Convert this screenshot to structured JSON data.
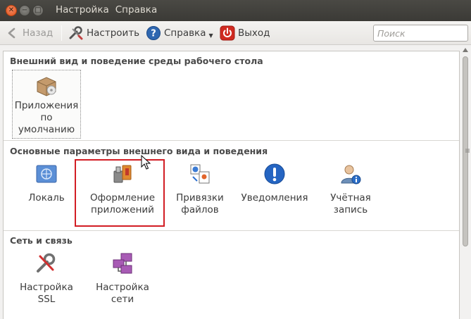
{
  "titlebar": {
    "menus": [
      "Настройка",
      "Справка"
    ]
  },
  "toolbar": {
    "back_label": "Назад",
    "configure_label": "Настроить",
    "help_label": "Справка",
    "exit_label": "Выход",
    "search_placeholder": "Поиск"
  },
  "sections": [
    {
      "title": "Внешний вид и поведение среды рабочего стола",
      "items": [
        {
          "label_lines": [
            "Приложения",
            "по",
            "умолчанию"
          ],
          "icon": "default-applications-icon"
        }
      ]
    },
    {
      "title": "Основные параметры внешнего вида и поведения",
      "items": [
        {
          "label_lines": [
            "Локаль"
          ],
          "icon": "locale-globe-icon"
        },
        {
          "label_lines": [
            "Оформление",
            "приложений"
          ],
          "icon": "application-appearance-icon"
        },
        {
          "label_lines": [
            "Привязки",
            "файлов"
          ],
          "icon": "file-associations-icon"
        },
        {
          "label_lines": [
            "Уведомления"
          ],
          "icon": "notifications-icon"
        },
        {
          "label_lines": [
            "Учётная",
            "запись"
          ],
          "icon": "account-details-icon"
        }
      ]
    },
    {
      "title": "Сеть и связь",
      "items": [
        {
          "label_lines": [
            "Настройка",
            "SSL"
          ],
          "icon": "ssl-settings-icon"
        },
        {
          "label_lines": [
            "Настройка",
            "сети"
          ],
          "icon": "network-settings-icon"
        }
      ]
    }
  ],
  "colors": {
    "highlight": "#d21d24",
    "titlebar": "#3c3b37"
  }
}
